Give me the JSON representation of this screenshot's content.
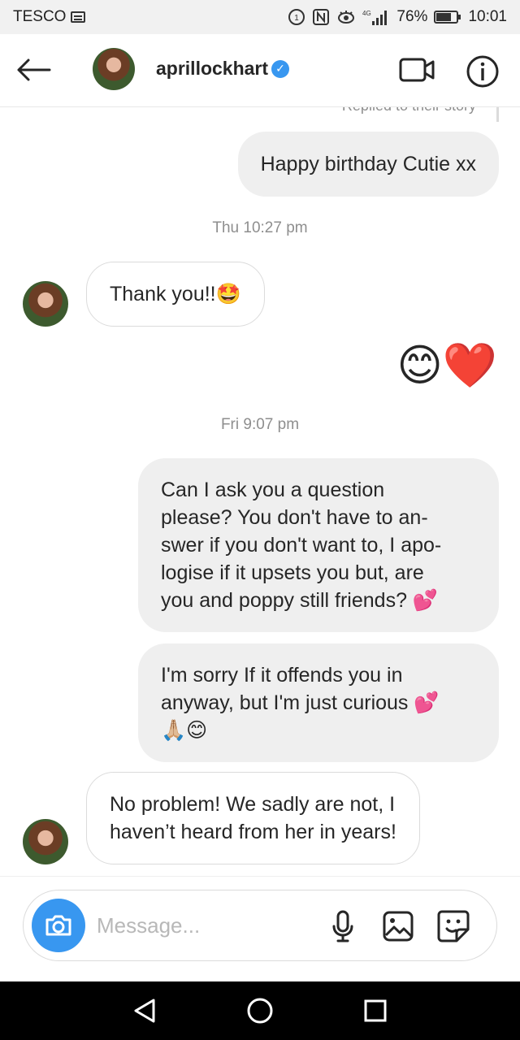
{
  "status_bar": {
    "carrier": "TESCO",
    "signal_label": "4G",
    "battery": "76%",
    "time": "10:01"
  },
  "header": {
    "username": "aprillockhart",
    "verified": true,
    "accent_color": "#3897f0"
  },
  "chat": {
    "replied_label": "Replied to their story",
    "messages": [
      {
        "from": "me",
        "text": "Happy birthday Cutie xx"
      },
      {
        "type": "timestamp",
        "text": "Thu 10:27 pm"
      },
      {
        "from": "them",
        "text": "Thank you!!🤩"
      },
      {
        "from": "me",
        "text": "😊❤️"
      },
      {
        "type": "timestamp",
        "text": "Fri 9:07 pm"
      },
      {
        "from": "me",
        "lines": [
          "Can I ask you a question",
          "please? You don't have to an-",
          "swer if you don't want to, I apo-",
          "logise if it upsets you but, are",
          "you and poppy still friends? 💕"
        ]
      },
      {
        "from": "me",
        "lines": [
          "I'm sorry If it offends you in",
          "anyway, but I'm just curious 💕",
          "🙏🏼😊"
        ]
      },
      {
        "from": "them",
        "lines": [
          "No problem! We sadly are not, I",
          "haven’t heard from her in years!"
        ]
      }
    ]
  },
  "composer": {
    "placeholder": "Message...",
    "value": ""
  },
  "icons": {
    "back": "back-arrow-icon",
    "video": "video-call-icon",
    "info": "info-icon",
    "camera": "camera-icon",
    "mic": "microphone-icon",
    "gallery": "gallery-icon",
    "sticker": "sticker-icon"
  }
}
